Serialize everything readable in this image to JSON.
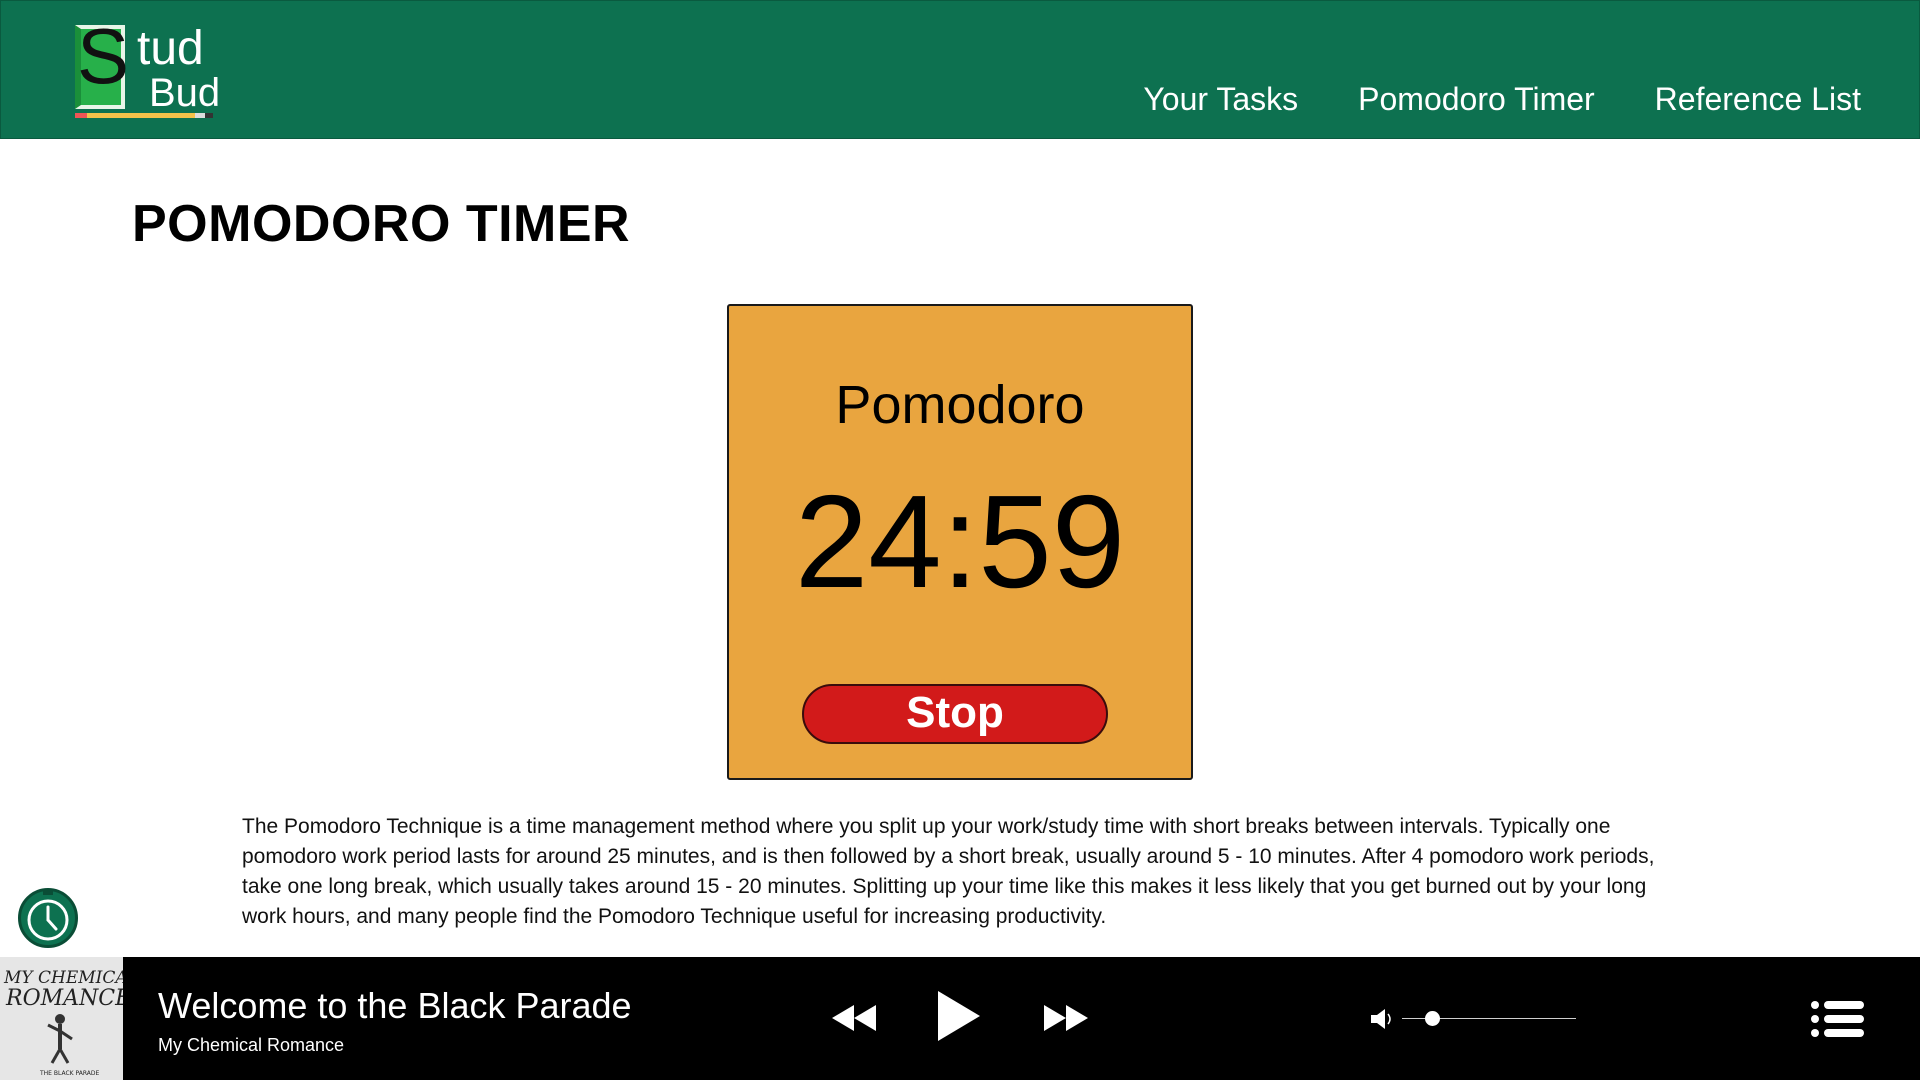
{
  "header": {
    "logo": {
      "letter": "S",
      "line1": "tud",
      "line2": "Bud"
    },
    "nav": [
      {
        "label": "Your Tasks"
      },
      {
        "label": "Pomodoro Timer"
      },
      {
        "label": "Reference List"
      }
    ],
    "brand_color": "#0d7150"
  },
  "main": {
    "title": "POMODORO TIMER",
    "timer": {
      "mode": "Pomodoro",
      "time": "24:59",
      "stop_label": "Stop",
      "card_color": "#e9a53f",
      "stop_color": "#d21a1a"
    },
    "description": "The Pomodoro Technique is a time management method where you split up your work/study time with short breaks between intervals. Typically one pomodoro work period lasts for around 25 minutes, and is then followed by a short break, usually around 5 - 10 minutes. After 4 pomodoro work periods, take one long break, which usually takes around 15 - 20 minutes. Splitting up your time like this makes it less likely that you get burned out by your long work hours, and many people find the Pomodoro Technique useful for increasing productivity."
  },
  "clock_button": {
    "icon": "clock-icon"
  },
  "player": {
    "track_title": "Welcome to the Black Parade",
    "artist": "My Chemical Romance",
    "album_art_text": "MY CHEMICAL ROMANCE",
    "album_caption": "THE BLACK PARADE",
    "icons": {
      "previous": "rewind-icon",
      "play": "play-icon",
      "next": "fast-forward-icon",
      "volume": "volume-icon",
      "playlist": "playlist-icon"
    },
    "volume_level": 0.17
  }
}
